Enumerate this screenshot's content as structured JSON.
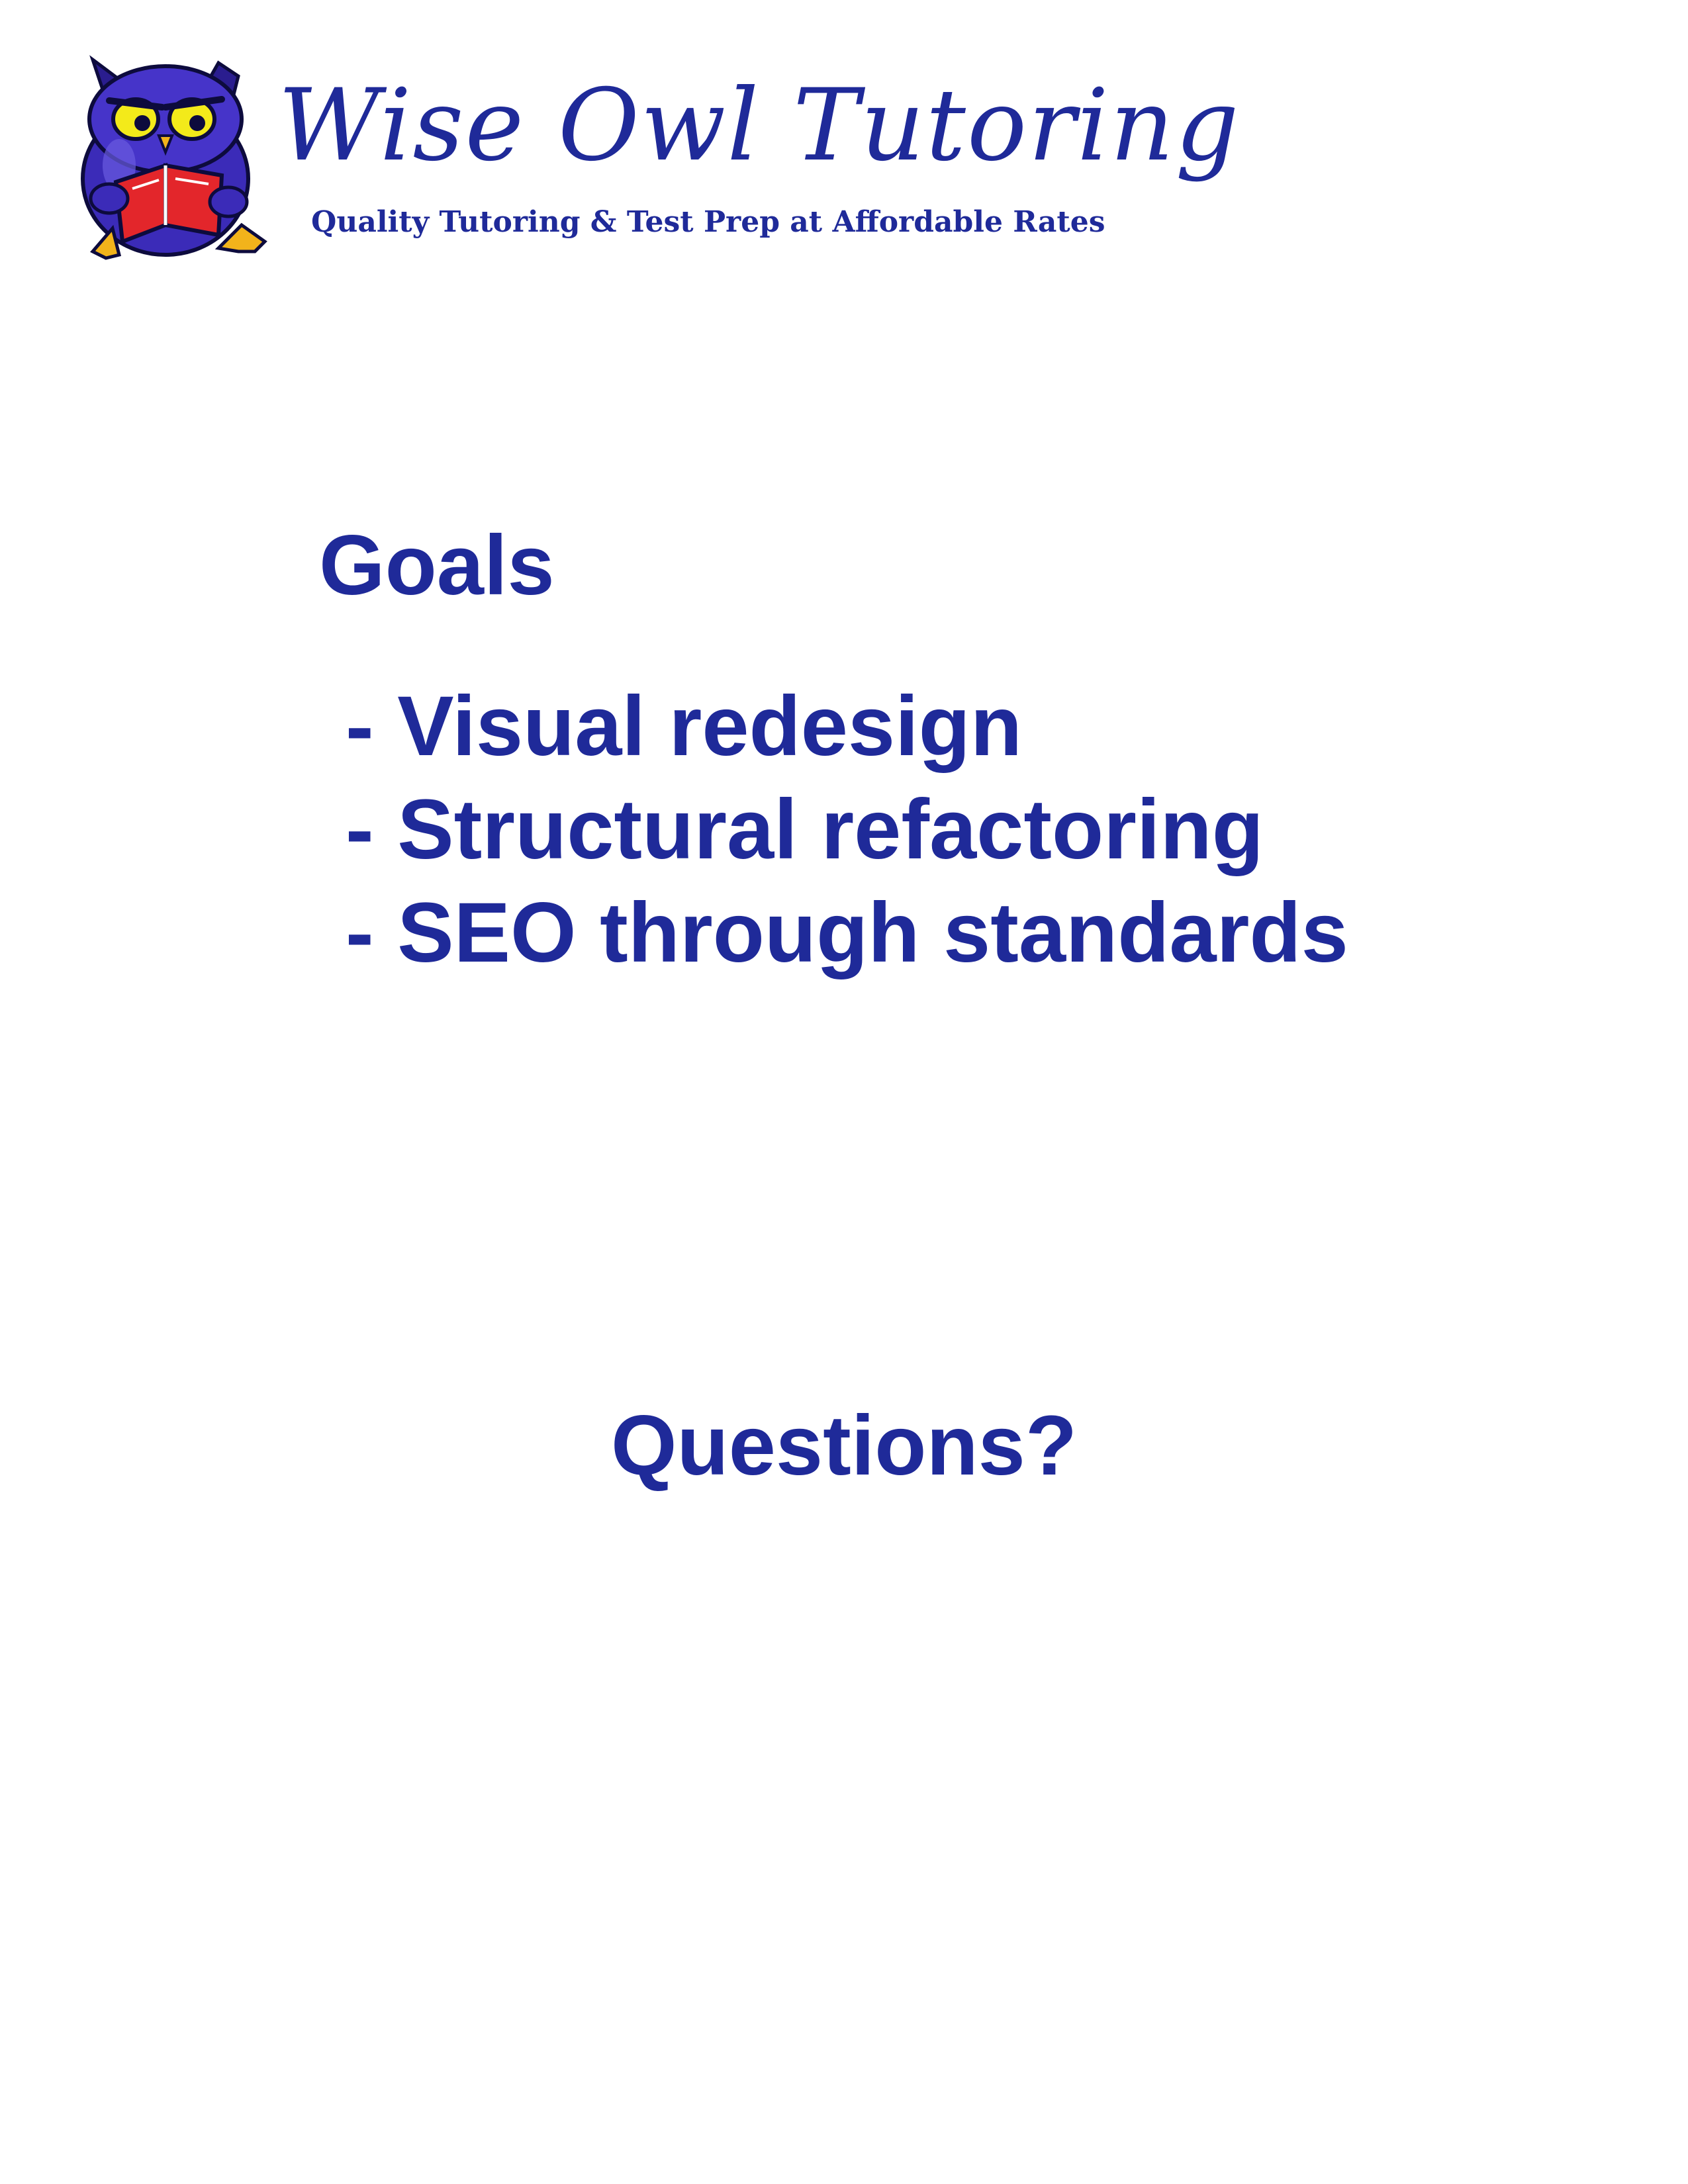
{
  "brand": {
    "title": "Wise Owl Tutoring",
    "tagline": "Quality Tutoring & Test Prep at Affordable Rates",
    "logo_icon": "owl-reading-book-icon"
  },
  "content": {
    "goals_heading": "Goals",
    "goals": [
      "- Visual redesign",
      "- Structural refactoring",
      "- SEO through standards"
    ],
    "questions": "Questions?"
  },
  "colors": {
    "text": "#1f2a99",
    "owl_body": "#3b2bb8",
    "owl_eyes": "#f3ea1a",
    "book": "#e3262b",
    "feet": "#f2b31b",
    "background": "#ffffff"
  }
}
